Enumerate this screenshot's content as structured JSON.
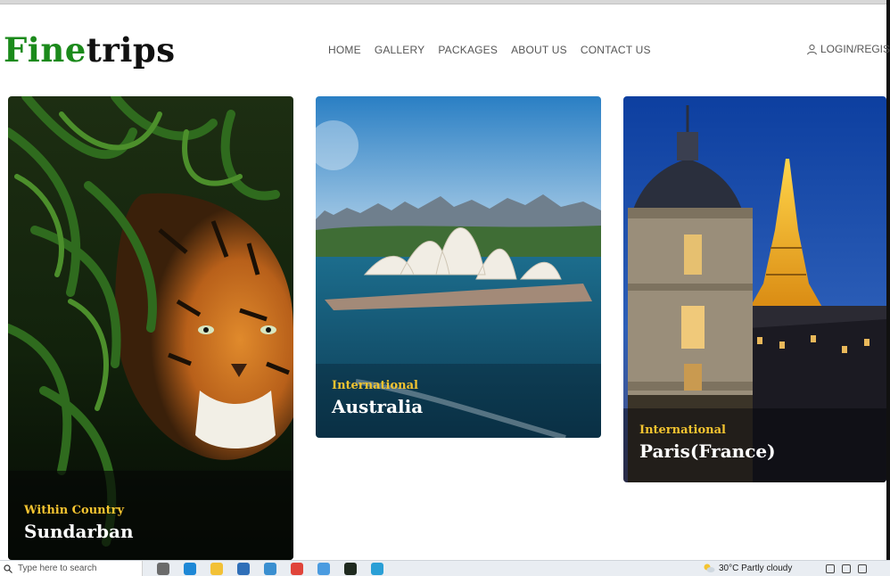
{
  "brand": {
    "part1": "Fine",
    "part2": "trips"
  },
  "nav": {
    "items": [
      "HOME",
      "GALLERY",
      "PACKAGES",
      "ABOUT US",
      "CONTACT US"
    ]
  },
  "login_label": "LOGIN/REGIS",
  "cards": [
    {
      "subtitle": "Within Country",
      "title": "Sundarban"
    },
    {
      "subtitle": "International",
      "title": "Australia"
    },
    {
      "subtitle": "International",
      "title": "Paris(France)"
    }
  ],
  "taskbar": {
    "search_placeholder": "Type here to search",
    "weather": "30°C  Partly cloudy"
  },
  "colors": {
    "brand_green": "#1b8a1b",
    "accent_gold": "#f4c430"
  }
}
